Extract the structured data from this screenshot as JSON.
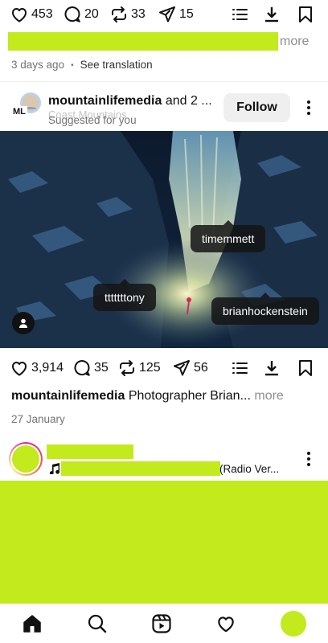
{
  "post1": {
    "likes": "453",
    "comments": "20",
    "reposts": "33",
    "shares": "15",
    "more_label": "more",
    "timestamp": "3 days ago",
    "dot": "•",
    "translate_label": "See translation"
  },
  "post2": {
    "username": "mountainlifemedia",
    "collab_suffix": "and 2 ...",
    "location": "Coast Mountains",
    "suggested": "Suggested for you",
    "follow_label": "Follow",
    "avatar_badge": "ML",
    "tags": [
      "timemmett",
      "tttttttony",
      "brianhockenstein"
    ],
    "likes": "3,914",
    "comments": "35",
    "reposts": "125",
    "shares": "56",
    "caption_user": "mountainlifemedia",
    "caption_text": "Photographer Brian...",
    "more_label": "more",
    "date": "27 January"
  },
  "post3": {
    "audio_suffix": "(Radio Ver..."
  },
  "colors": {
    "redaction": "#c2ea1c",
    "text": "#111111",
    "muted": "#737373"
  },
  "icons": [
    "heart-icon",
    "comment-icon",
    "repost-icon",
    "send-icon",
    "list-icon",
    "download-icon",
    "bookmark-icon",
    "more-vertical-icon",
    "music-note-icon",
    "user-tag-icon",
    "home-icon",
    "search-icon",
    "reels-icon"
  ]
}
